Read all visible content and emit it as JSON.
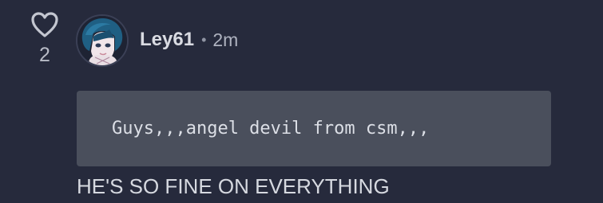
{
  "comment": {
    "likes": "2",
    "author": {
      "username": "Ley61",
      "time_ago": "2m"
    },
    "separator": "•",
    "code_block": "Guys,,,angel devil from csm,,,",
    "text": "HE'S SO FINE ON EVERYTHING"
  },
  "colors": {
    "background": "#262a3c",
    "code_background": "#4a4f5c",
    "text": "#d6d9e0",
    "muted": "#aeb2bf"
  },
  "icons": {
    "like": "heart-outline-icon"
  }
}
